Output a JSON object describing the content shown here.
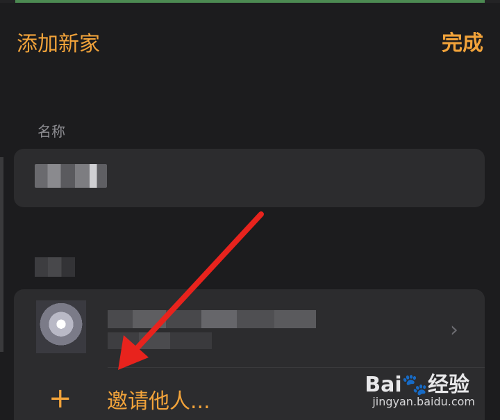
{
  "nav": {
    "title": "添加新家",
    "done_label": "完成"
  },
  "form": {
    "name_section_label": "名称"
  },
  "members": {
    "invite_label": "邀请他人...",
    "plus_icon": "plus-icon",
    "chevron_icon": "chevron-right-icon"
  },
  "watermark": {
    "logo_text": "Bai🐾经验",
    "url": "jingyan.baidu.com"
  },
  "colors": {
    "accent": "#f2a33a",
    "background": "#1c1c1e",
    "card": "#2c2c2e",
    "annotation_arrow": "#e8231d"
  }
}
